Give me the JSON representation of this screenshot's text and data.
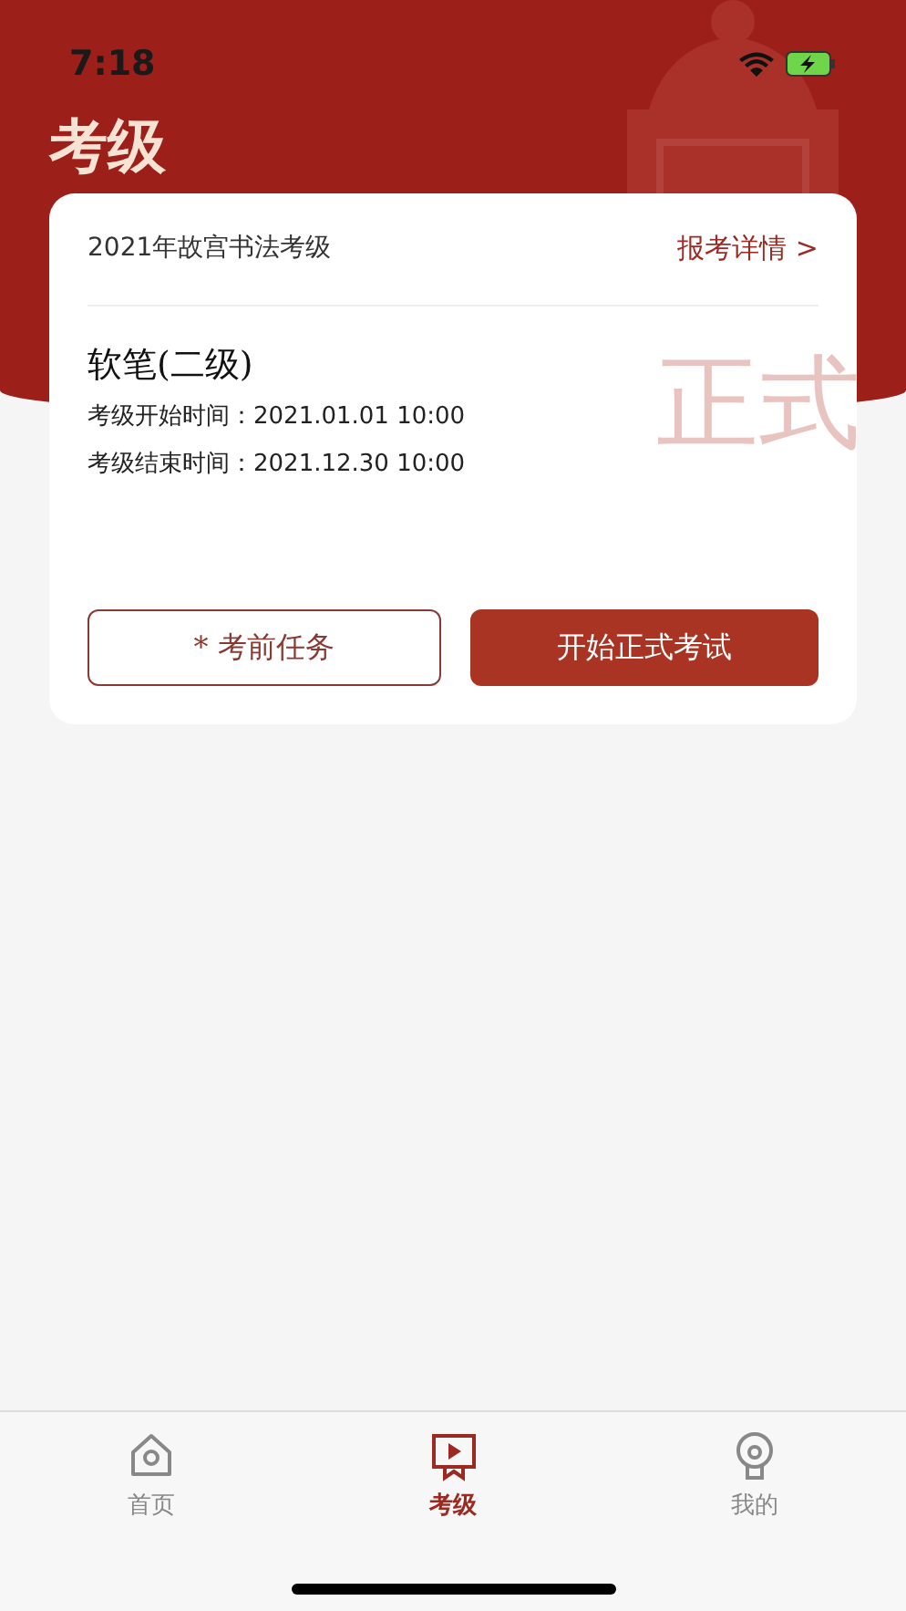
{
  "status_bar": {
    "time": "7:18"
  },
  "header": {
    "title": "考级"
  },
  "exam_card": {
    "title": "2021年故宫书法考级",
    "details_link": "报考详情 >",
    "level_name": "软笔(二级)",
    "decoration_text": "正式",
    "times": [
      {
        "label": "考级开始时间：",
        "value": "2021.01.01 10:00"
      },
      {
        "label": "考级结束时间：",
        "value": "2021.12.30 10:00"
      }
    ],
    "buttons": [
      {
        "kind": "outline",
        "label": "* 考前任务"
      },
      {
        "kind": "filled",
        "label": "开始正式考试"
      }
    ]
  },
  "tab_bar": [
    {
      "kind": "home",
      "label": "首页",
      "selected": false
    },
    {
      "kind": "exam",
      "label": "考级",
      "selected": true
    },
    {
      "kind": "profile",
      "label": "我的",
      "selected": false
    }
  ]
}
